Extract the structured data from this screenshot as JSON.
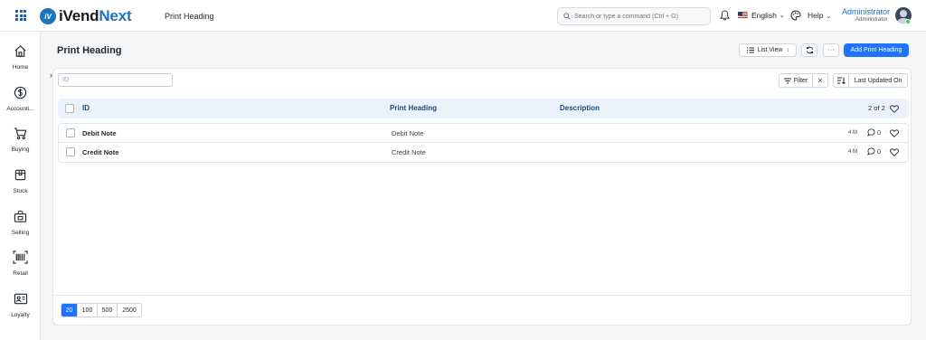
{
  "navbar": {
    "brand_prefix": "iVend",
    "brand_suffix": "Next",
    "logo_mark": "iV",
    "page_title": "Print Heading",
    "search_placeholder": "Search or type a command (Ctrl + G)",
    "language": "English",
    "help": "Help",
    "user_name": "Administrator",
    "user_role": "Administrator"
  },
  "sidebar": {
    "items": [
      {
        "label": "Home",
        "icon": "home-icon"
      },
      {
        "label": "Accounti...",
        "icon": "dollar-icon"
      },
      {
        "label": "Buying",
        "icon": "cart-icon"
      },
      {
        "label": "Stock",
        "icon": "box-icon"
      },
      {
        "label": "Selling",
        "icon": "shop-icon"
      },
      {
        "label": "Retail",
        "icon": "barcode-icon"
      },
      {
        "label": "Loyalty",
        "icon": "id-card-icon"
      }
    ]
  },
  "page": {
    "title": "Print Heading",
    "list_view": "List View",
    "more": "···",
    "add_button": "Add Print Heading"
  },
  "filters": {
    "id_placeholder": "ID",
    "filter": "Filter",
    "clear": "×",
    "sort_by": "Last Updated On"
  },
  "list": {
    "columns": {
      "id": "ID",
      "heading": "Print Heading",
      "description": "Description"
    },
    "count": "2 of 2",
    "rows": [
      {
        "id": "Debit Note",
        "heading": "Debit Note",
        "modified": "4 M",
        "comments": "0"
      },
      {
        "id": "Credit Note",
        "heading": "Credit Note",
        "modified": "4 M",
        "comments": "0"
      }
    ]
  },
  "paging": {
    "sizes": [
      "20",
      "100",
      "500",
      "2500"
    ],
    "selected": "20"
  },
  "colors": {
    "primary": "#1e73ff",
    "brand": "#1e73be",
    "header_bg": "#eaf2fb"
  }
}
